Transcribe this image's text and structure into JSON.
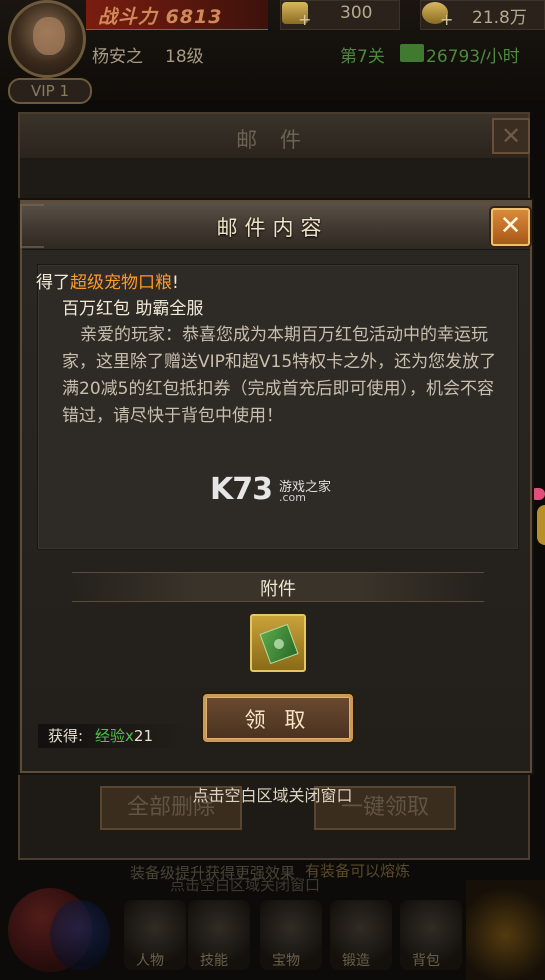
{
  "player": {
    "power_label": "战斗力 6813",
    "gold": "300",
    "silver": "21.8万",
    "name": "杨安之",
    "level": "18级",
    "stage": "第7关",
    "rate": "26793/小时",
    "vip": "VIP 1"
  },
  "background_window": {
    "title": "邮 件",
    "close": "✕",
    "delete_all": "全部删除",
    "claim_all": "一键领取",
    "hint_upgrade": "装备级提升获得更强效果",
    "hint_smelt": "有装备可以熔炼",
    "hint_close": "点击空白区域关闭窗口"
  },
  "bottom_nav": {
    "items": [
      "人物",
      "技能",
      "宝物",
      "锻造",
      "背包"
    ]
  },
  "dialog": {
    "title": "邮件内容",
    "close": "✕",
    "got_prefix": "得了",
    "got_item": "超级宠物口粮",
    "got_suffix": "!",
    "subject": "百万红包 助霸全服",
    "body": "亲爱的玩家：恭喜您成为本期百万红包活动中的幸运玩家，这里除了赠送VIP和超V15特权卡之外，还为您发放了满20减5的红包抵扣券（完成首充后即可使用），机会不容错过，请尽快于背包中使用！",
    "attachment_title": "附件",
    "attachment_item_icon": "red-envelope-voucher-icon",
    "claim_button": "领 取",
    "reward_label": "获得:",
    "reward_name": "经验",
    "reward_mult": "x",
    "reward_amount": "21",
    "close_hint": "点击空白区域关闭窗口"
  },
  "watermark": {
    "brand": "K73",
    "cn": "游戏之家",
    "com": ".com"
  },
  "colors": {
    "highlight_orange": "#ff9a2a",
    "reward_green": "#4fc048",
    "close_button": "#d98a3a"
  }
}
